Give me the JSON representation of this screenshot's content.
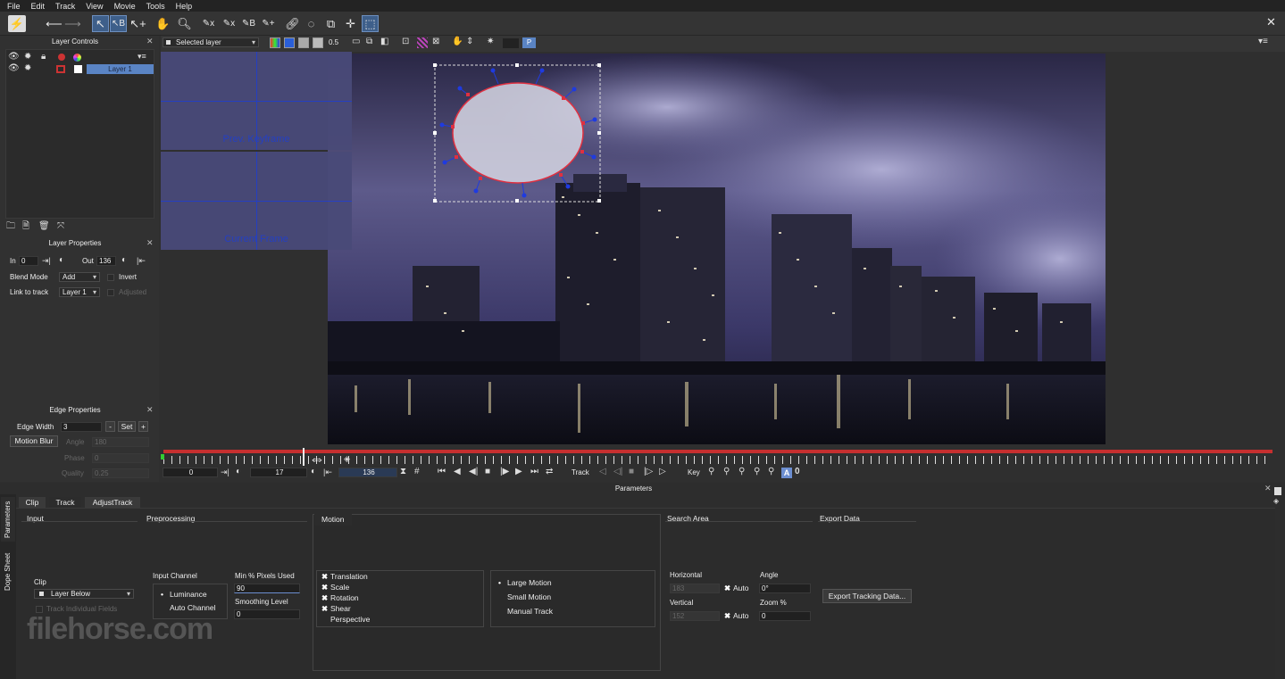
{
  "menu": [
    "File",
    "Edit",
    "Track",
    "View",
    "Movie",
    "Tools",
    "Help"
  ],
  "layer_controls": {
    "title": "Layer Controls",
    "layer_name": "Layer 1"
  },
  "view_bar": {
    "selected_layer": "Selected layer",
    "opacity": "0.5",
    "p_label": "P"
  },
  "magnifier": {
    "prev_label": "Prev. Keyframe",
    "current_label": "Current Frame"
  },
  "layer_properties": {
    "title": "Layer Properties",
    "in_label": "In",
    "in_value": "0",
    "out_label": "Out",
    "out_value": "136",
    "blend_label": "Blend Mode",
    "blend_value": "Add",
    "invert_label": "Invert",
    "link_label": "Link to track",
    "link_value": "Layer 1",
    "adjusted_label": "Adjusted"
  },
  "edge_properties": {
    "title": "Edge Properties",
    "edge_width_label": "Edge Width",
    "edge_width_value": "3",
    "minus": "-",
    "set": "Set",
    "plus": "+",
    "motion_blur": "Motion Blur",
    "angle_label": "Angle",
    "angle_value": "180",
    "phase_label": "Phase",
    "phase_value": "0",
    "quality_label": "Quality",
    "quality_value": "0.25"
  },
  "timeline": {
    "start": "0",
    "current": "17",
    "end": "136",
    "track_label": "Track",
    "key_label": "Key"
  },
  "parameters": {
    "title": "Parameters",
    "side_tabs": [
      "Parameters",
      "Dope Sheet"
    ],
    "tabs": [
      "Clip",
      "Track",
      "AdjustTrack"
    ],
    "input": {
      "title": "Input",
      "clip_label": "Clip",
      "clip_value": "Layer Below",
      "track_fields": "Track Individual Fields"
    },
    "preprocessing": {
      "title": "Preprocessing",
      "input_channel": "Input Channel",
      "luminance": "Luminance",
      "auto_channel": "Auto Channel",
      "min_pixels": "Min % Pixels Used",
      "min_pixels_value": "90",
      "smoothing": "Smoothing Level",
      "smoothing_value": "0"
    },
    "motion": {
      "title": "Motion",
      "items": [
        "Translation",
        "Scale",
        "Rotation",
        "Shear",
        "Perspective"
      ],
      "modes": [
        "Large Motion",
        "Small Motion",
        "Manual Track"
      ]
    },
    "search_area": {
      "title": "Search Area",
      "horizontal": "Horizontal",
      "horizontal_value": "183",
      "vertical": "Vertical",
      "vertical_value": "152",
      "auto": "Auto",
      "angle": "Angle",
      "angle_value": "0°",
      "zoom": "Zoom %",
      "zoom_value": "0"
    },
    "export": {
      "title": "Export Data",
      "button": "Export Tracking Data..."
    }
  },
  "watermark": "filehorse.com",
  "colors": {
    "accent_blue": "#5a84c4",
    "timeline_red": "#c62f2f",
    "spline_red": "#e03040",
    "handle_blue": "#1f3be0"
  }
}
